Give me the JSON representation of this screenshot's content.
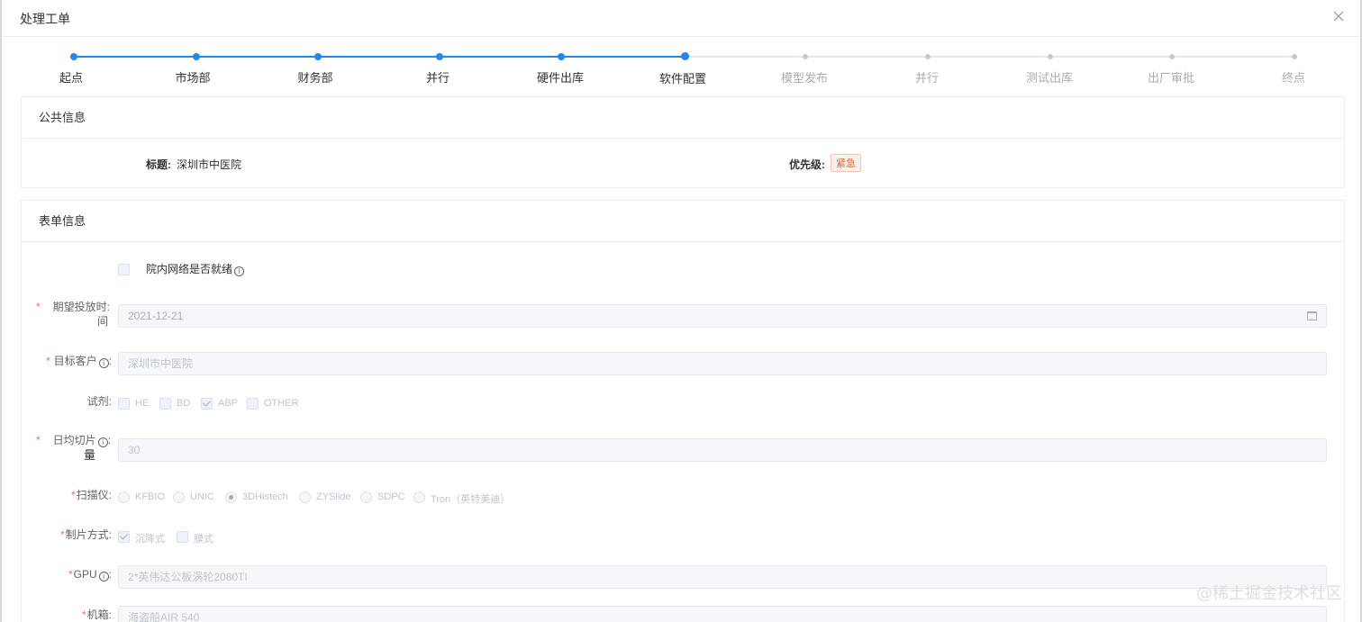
{
  "dialog": {
    "title": "处理工单"
  },
  "steps": [
    {
      "label": "起点",
      "status": "done"
    },
    {
      "label": "市场部",
      "status": "done"
    },
    {
      "label": "财务部",
      "status": "done"
    },
    {
      "label": "并行",
      "status": "done"
    },
    {
      "label": "硬件出库",
      "status": "done"
    },
    {
      "label": "软件配置",
      "status": "current"
    },
    {
      "label": "模型发布",
      "status": "todo"
    },
    {
      "label": "并行",
      "status": "todo"
    },
    {
      "label": "测试出库",
      "status": "todo"
    },
    {
      "label": "出厂审批",
      "status": "todo"
    },
    {
      "label": "终点",
      "status": "todo"
    }
  ],
  "public_info": {
    "header": "公共信息",
    "title_label": "标题:",
    "title_value": "深圳市中医院",
    "priority_label": "优先级:",
    "priority_value": "紧急"
  },
  "form_info": {
    "header": "表单信息",
    "network_ready_label": "院内网络是否就绪",
    "expected_date_label_1": "期望投放时:",
    "expected_date_label_2": "间",
    "expected_date_value": "2021-12-21",
    "target_customer_label": "目标客户",
    "target_customer_value": "深圳市中医院",
    "reagent_label": "试剂:",
    "reagent_options": [
      "HE",
      "BD",
      "ABP",
      "OTHER"
    ],
    "reagent_checked": "ABP",
    "daily_slices_label_1": "日均切片",
    "daily_slices_label_2": "量",
    "daily_slices_value": "30",
    "scanner_label": "扫描仪:",
    "scanner_options": [
      "KFBIO",
      "UNIC",
      "3DHistech",
      "ZYSlide",
      "SDPC",
      "Tron（英特美迪）"
    ],
    "scanner_selected": "3DHistech",
    "slice_method_label": "制片方式:",
    "slice_method_options": [
      "沉降式",
      "膜式"
    ],
    "slice_method_checked": "沉降式",
    "gpu_label": "GPU",
    "gpu_value": "2*英伟达公板涡轮2080TI",
    "chassis_label": "机箱:",
    "chassis_value": "海盗船AIR 540",
    "colon": ":"
  },
  "watermark": "@稀土掘金技术社区",
  "colors": {
    "accent": "#2388e8",
    "danger": "#f56c6c",
    "badge": "#e6612d"
  }
}
